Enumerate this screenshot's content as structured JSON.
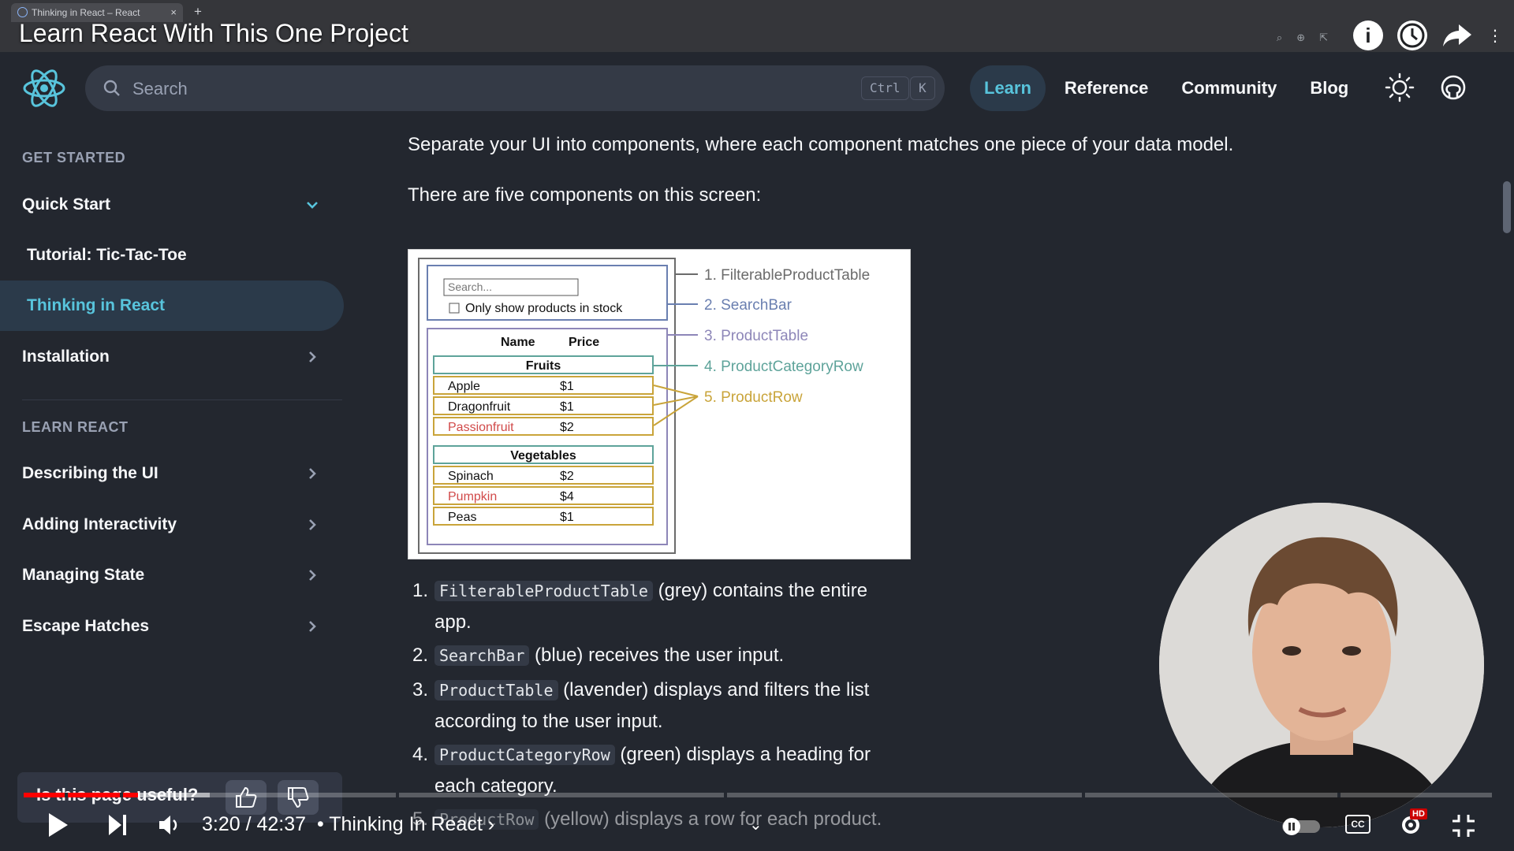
{
  "browser": {
    "tab_title": "Thinking in React – React",
    "tab_close": "×",
    "new_tab": "+"
  },
  "video": {
    "title": "Learn React With This One Project",
    "info_icon": "i",
    "time": "3:20 / 42:37",
    "chapter": "• Thinking In React ›",
    "chapter_chevron": "⌄",
    "progress_played": 0.078,
    "progress_buffered": 0.127
  },
  "nav": {
    "search_placeholder": "Search",
    "kbd_ctrl": "Ctrl",
    "kbd_k": "K",
    "links": [
      {
        "label": "Learn",
        "active": true
      },
      {
        "label": "Reference",
        "active": false
      },
      {
        "label": "Community",
        "active": false
      },
      {
        "label": "Blog",
        "active": false
      }
    ]
  },
  "sidebar": {
    "get_started": "GET STARTED",
    "learn_react": "LEARN REACT",
    "items": [
      {
        "label": "Quick Start"
      },
      {
        "label": "Tutorial: Tic-Tac-Toe"
      },
      {
        "label": "Thinking in React"
      },
      {
        "label": "Installation"
      },
      {
        "label": "Describing the UI"
      },
      {
        "label": "Adding Interactivity"
      },
      {
        "label": "Managing State"
      },
      {
        "label": "Escape Hatches"
      }
    ]
  },
  "content": {
    "para1": "Separate your UI into components, where each component matches one piece of your data model.",
    "para2": "There are five components on this screen:",
    "diagram": {
      "search_placeholder": "Search...",
      "checkbox_label": "Only show products in stock",
      "col_name": "Name",
      "col_price": "Price",
      "categories": [
        {
          "name": "Fruits",
          "rows": [
            {
              "name": "Apple",
              "price": "$1",
              "stocked": true
            },
            {
              "name": "Dragonfruit",
              "price": "$1",
              "stocked": true
            },
            {
              "name": "Passionfruit",
              "price": "$2",
              "stocked": false
            }
          ]
        },
        {
          "name": "Vegetables",
          "rows": [
            {
              "name": "Spinach",
              "price": "$2",
              "stocked": true
            },
            {
              "name": "Pumpkin",
              "price": "$4",
              "stocked": false
            },
            {
              "name": "Peas",
              "price": "$1",
              "stocked": true
            }
          ]
        }
      ],
      "labels": [
        "1. FilterableProductTable",
        "2. SearchBar",
        "3. ProductTable",
        "4. ProductCategoryRow",
        "5. ProductRow"
      ],
      "colors": {
        "grey": "#6b6b6b",
        "blue": "#6a7fb0",
        "lavender": "#8d86b8",
        "green": "#5ea39a",
        "yellow": "#c9a43a",
        "out_of_stock": "#d14a4a"
      }
    },
    "list": [
      {
        "num": "1.",
        "code": "FilterableProductTable",
        "text_a": " (grey) contains the entire",
        "text_b": "app."
      },
      {
        "num": "2.",
        "code": "SearchBar",
        "text_a": " (blue) receives the user input.",
        "text_b": ""
      },
      {
        "num": "3.",
        "code": "ProductTable",
        "text_a": " (lavender) displays and filters the list",
        "text_b": "according to the user input."
      },
      {
        "num": "4.",
        "code": "ProductCategoryRow",
        "text_a": " (green) displays a heading for",
        "text_b": "each category."
      },
      {
        "num": "5.",
        "code": "ProductRow",
        "text_a": " (yellow) displays a row for each product.",
        "text_b": ""
      }
    ]
  },
  "feedback": {
    "question": "Is this page useful?"
  },
  "yt_controls": {
    "hd_badge": "HD",
    "cc_label": "CC"
  }
}
